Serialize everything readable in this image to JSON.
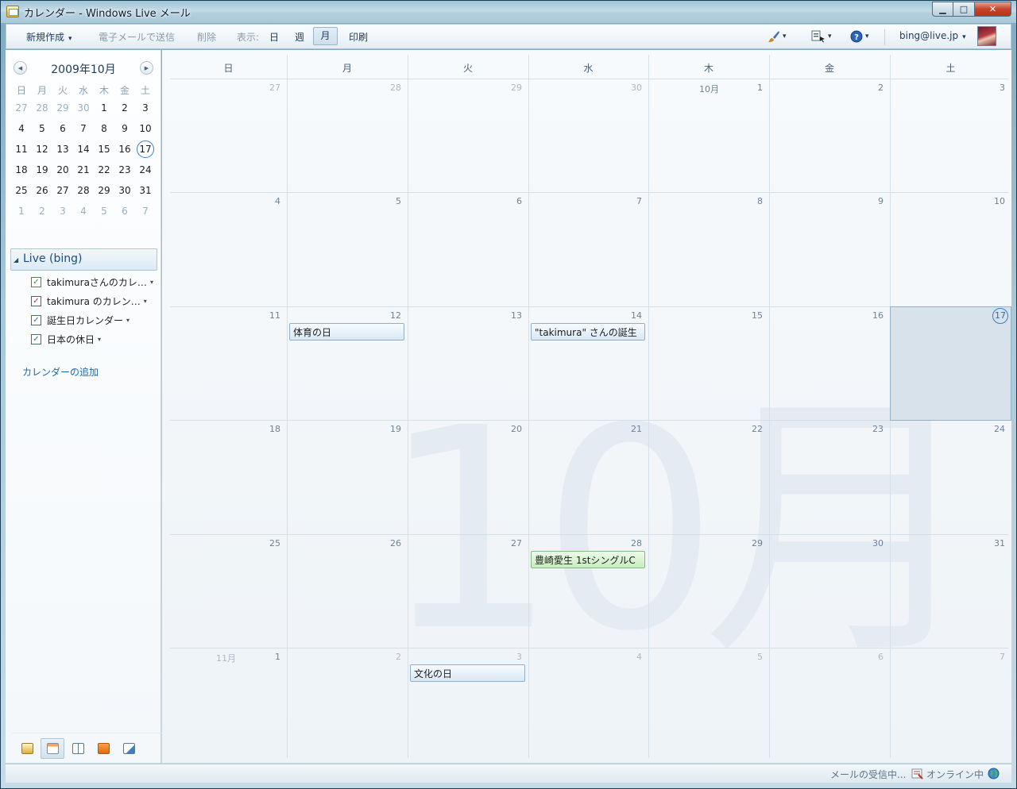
{
  "window": {
    "title": "カレンダー - Windows Live メール"
  },
  "toolbar": {
    "new": "新規作成",
    "send_email": "電子メールで送信",
    "delete": "削除",
    "view_label": "表示:",
    "view_day": "日",
    "view_week": "週",
    "view_month": "月",
    "print": "印刷",
    "account": "bing@live.jp"
  },
  "mini_calendar": {
    "title": "2009年10月",
    "weekdays": [
      "日",
      "月",
      "火",
      "水",
      "木",
      "金",
      "土"
    ],
    "weeks": [
      [
        "27",
        "28",
        "29",
        "30",
        "1",
        "2",
        "3"
      ],
      [
        "4",
        "5",
        "6",
        "7",
        "8",
        "9",
        "10"
      ],
      [
        "11",
        "12",
        "13",
        "14",
        "15",
        "16",
        "17"
      ],
      [
        "18",
        "19",
        "20",
        "21",
        "22",
        "23",
        "24"
      ],
      [
        "25",
        "26",
        "27",
        "28",
        "29",
        "30",
        "31"
      ],
      [
        "1",
        "2",
        "3",
        "4",
        "5",
        "6",
        "7"
      ]
    ]
  },
  "calendars": {
    "group": "Live (bing)",
    "items": [
      {
        "name": "takimuraさんのカレ…",
        "color": "#3f8f3f"
      },
      {
        "name": "takimura のカレン…",
        "color": "#b0306a"
      },
      {
        "name": "誕生日カレンダー",
        "color": "#3a6aa0"
      },
      {
        "name": "日本の休日",
        "color": "#3a6aa0"
      }
    ],
    "add": "カレンダーの追加"
  },
  "month_view": {
    "watermark": "10月",
    "weekdays": [
      "日",
      "月",
      "火",
      "水",
      "木",
      "金",
      "土"
    ],
    "weeks": [
      [
        "27",
        "28",
        "29",
        "30",
        "1",
        "2",
        "3"
      ],
      [
        "4",
        "5",
        "6",
        "7",
        "8",
        "9",
        "10"
      ],
      [
        "11",
        "12",
        "13",
        "14",
        "15",
        "16",
        "17"
      ],
      [
        "18",
        "19",
        "20",
        "21",
        "22",
        "23",
        "24"
      ],
      [
        "25",
        "26",
        "27",
        "28",
        "29",
        "30",
        "31"
      ],
      [
        "1",
        "2",
        "3",
        "4",
        "5",
        "6",
        "7"
      ]
    ],
    "month_labels": {
      "oct": "10月",
      "nov": "11月"
    },
    "events": {
      "sports_day": "体育の日",
      "birthday": "\"takimura\" さんの誕生",
      "single": "豊崎愛生 1stシングルC",
      "culture_day": "文化の日"
    }
  },
  "status": {
    "receiving": "メールの受信中...",
    "online": "オンライン中"
  }
}
